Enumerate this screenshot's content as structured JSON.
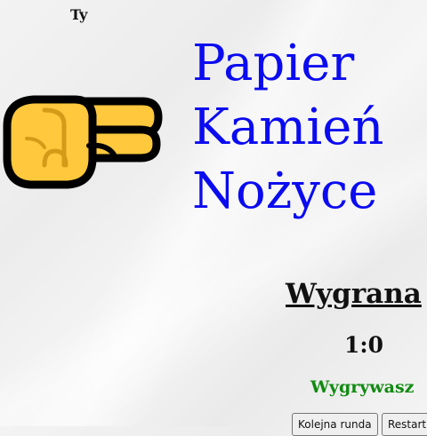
{
  "player": {
    "label": "Ty"
  },
  "hand": {
    "icon": "pointing-hand-icon",
    "skin_color": "#FFC83D",
    "shade_color": "#D39B17",
    "outline_color": "#000000"
  },
  "title": {
    "line1": "Papier",
    "line2": "Kamień",
    "line3": "Nożyce",
    "color": "#0B0BF0"
  },
  "result": {
    "heading": "Wygrana",
    "score": "1:0",
    "status": "Wygrywasz",
    "status_color": "#118A11"
  },
  "buttons": {
    "next_round": "Kolejna runda",
    "restart": "Restart"
  }
}
